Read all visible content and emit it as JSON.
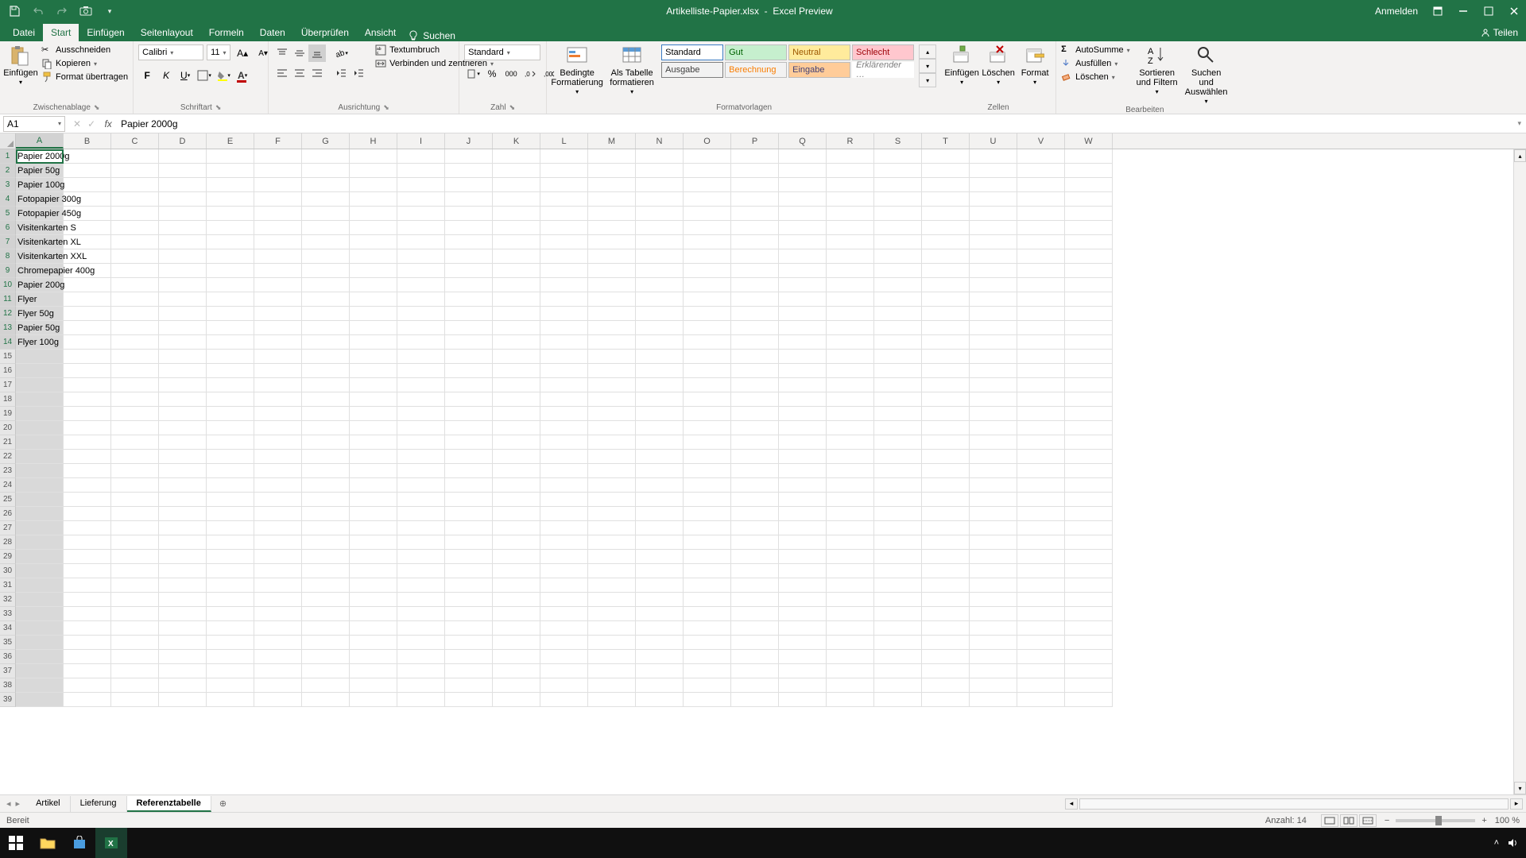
{
  "titlebar": {
    "filename": "Artikelliste-Papier.xlsx",
    "app": "Excel Preview",
    "signin": "Anmelden"
  },
  "tabs": {
    "file": "Datei",
    "home": "Start",
    "insert": "Einfügen",
    "pagelayout": "Seitenlayout",
    "formulas": "Formeln",
    "data": "Daten",
    "review": "Überprüfen",
    "view": "Ansicht",
    "search": "Suchen",
    "share": "Teilen"
  },
  "ribbon": {
    "clipboard": {
      "paste": "Einfügen",
      "cut": "Ausschneiden",
      "copy": "Kopieren",
      "formatpainter": "Format übertragen",
      "label": "Zwischenablage"
    },
    "font": {
      "name": "Calibri",
      "size": "11",
      "label": "Schriftart"
    },
    "align": {
      "wrap": "Textumbruch",
      "merge": "Verbinden und zentrieren",
      "label": "Ausrichtung"
    },
    "number": {
      "format": "Standard",
      "label": "Zahl"
    },
    "cond": {
      "conditional": "Bedingte Formatierung",
      "astable": "Als Tabelle formatieren"
    },
    "styles": {
      "row1": [
        "Standard",
        "Gut",
        "Neutral",
        "Schlecht"
      ],
      "row2": [
        "Ausgabe",
        "Berechnung",
        "Eingabe",
        "Erklärender …"
      ],
      "label": "Formatvorlagen"
    },
    "cells": {
      "insert": "Einfügen",
      "delete": "Löschen",
      "format": "Format",
      "label": "Zellen"
    },
    "editing": {
      "autosum": "AutoSumme",
      "fill": "Ausfüllen",
      "clear": "Löschen",
      "sort": "Sortieren und Filtern",
      "find": "Suchen und Auswählen",
      "label": "Bearbeiten"
    }
  },
  "formula": {
    "ref": "A1",
    "value": "Papier 2000g"
  },
  "columns": [
    "A",
    "B",
    "C",
    "D",
    "E",
    "F",
    "G",
    "H",
    "I",
    "J",
    "K",
    "L",
    "M",
    "N",
    "O",
    "P",
    "Q",
    "R",
    "S",
    "T",
    "U",
    "V",
    "W"
  ],
  "data_rows": [
    "Papier 2000g",
    "Papier 50g",
    "Papier 100g",
    "Fotopapier 300g",
    "Fotopapier 450g",
    "Visitenkarten S",
    "Visitenkarten XL",
    "Visitenkarten XXL",
    "Chromepapier 400g",
    "Papier 200g",
    "Flyer",
    "Flyer 50g",
    "Papier 50g",
    "Flyer 100g"
  ],
  "total_rows": 39,
  "sheets": {
    "nav_prev": "‹",
    "nav_next": "›",
    "tabs": [
      "Artikel",
      "Lieferung",
      "Referenztabelle"
    ],
    "active": 2
  },
  "status": {
    "ready": "Bereit",
    "count_label": "Anzahl:",
    "count": "14",
    "zoom": "100 %"
  },
  "style_colors": {
    "row1": [
      {
        "bg": "#ffffff",
        "fg": "#000000",
        "border": "#3b7cc4"
      },
      {
        "bg": "#c6efce",
        "fg": "#006100",
        "border": "#bdbdbd"
      },
      {
        "bg": "#ffeb9c",
        "fg": "#9c5700",
        "border": "#bdbdbd"
      },
      {
        "bg": "#ffc7ce",
        "fg": "#9c0006",
        "border": "#bdbdbd"
      }
    ],
    "row2": [
      {
        "bg": "#f2f2f2",
        "fg": "#3f3f3f",
        "border": "#7f7f7f"
      },
      {
        "bg": "#f2f2f2",
        "fg": "#fa7d00",
        "border": "#bdbdbd"
      },
      {
        "bg": "#ffcc99",
        "fg": "#3f3f76",
        "border": "#bdbdbd"
      },
      {
        "bg": "#ffffff",
        "fg": "#7f7f7f",
        "border": "#ffffff",
        "italic": true
      }
    ]
  }
}
